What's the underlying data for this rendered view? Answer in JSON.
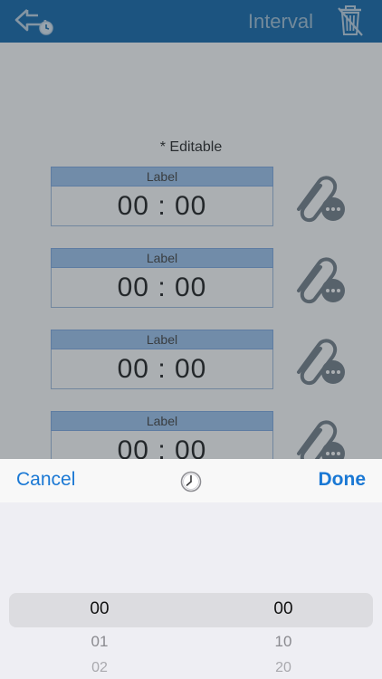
{
  "header": {
    "title": "Interval",
    "back_icon": "back-clock-icon",
    "trash_icon": "trash-icon"
  },
  "content": {
    "editable_note": "* Editable",
    "slots": [
      {
        "label": "Label",
        "time": "00 : 00",
        "attach_icon": "paperclip-more-icon"
      },
      {
        "label": "Label",
        "time": "00 : 00",
        "attach_icon": "paperclip-more-icon"
      },
      {
        "label": "Label",
        "time": "00 : 00",
        "attach_icon": "paperclip-more-icon"
      },
      {
        "label": "Label",
        "time": "00 : 00",
        "attach_icon": "paperclip-more-icon"
      }
    ]
  },
  "picker": {
    "cancel_label": "Cancel",
    "done_label": "Done",
    "clock_icon": "clock-icon",
    "left_column": {
      "selected": "00",
      "next": [
        "01",
        "02"
      ]
    },
    "right_column": {
      "selected": "00",
      "next": [
        "10",
        "20"
      ]
    }
  },
  "colors": {
    "header_bg": "#0a63a9",
    "accent": "#1a78d4",
    "label_bg": "#9cc3f0"
  }
}
